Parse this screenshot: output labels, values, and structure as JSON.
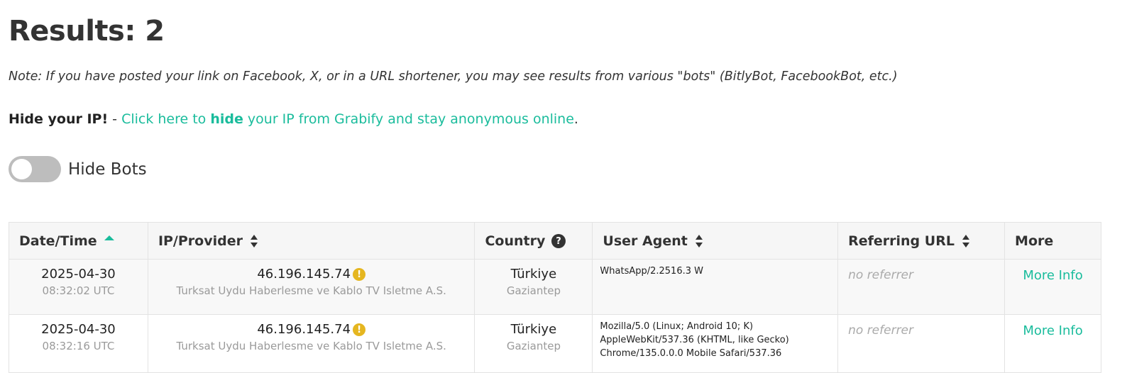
{
  "title": "Results: 2",
  "note": "Note: If you have posted your link on Facebook, X, or in a URL shortener, you may see results from various \"bots\" (BitlyBot, FacebookBot, etc.)",
  "hide_ip": {
    "lead": "Hide your IP!",
    "dash": " - ",
    "link_pre": "Click here to ",
    "link_bold": "hide",
    "link_post": " your IP from Grabify and stay anonymous online",
    "period": "."
  },
  "toggle": {
    "label": "Hide Bots",
    "on": false
  },
  "columns": {
    "datetime": "Date/Time",
    "ip": "IP/Provider",
    "country": "Country",
    "country_help": "?",
    "ua": "User Agent",
    "ref": "Referring URL",
    "more": "More"
  },
  "rows": [
    {
      "date": "2025-04-30",
      "time": "08:32:02 UTC",
      "ip": "46.196.145.74",
      "provider": "Turksat Uydu Haberlesme ve Kablo TV Isletme A.S.",
      "country": "Türkiye",
      "city": "Gaziantep",
      "user_agent": "WhatsApp/2.2516.3 W",
      "referrer": "no referrer",
      "more": "More Info"
    },
    {
      "date": "2025-04-30",
      "time": "08:32:16 UTC",
      "ip": "46.196.145.74",
      "provider": "Turksat Uydu Haberlesme ve Kablo TV Isletme A.S.",
      "country": "Türkiye",
      "city": "Gaziantep",
      "user_agent": "Mozilla/5.0 (Linux; Android 10; K) AppleWebKit/537.36 (KHTML, like Gecko) Chrome/135.0.0.0 Mobile Safari/537.36",
      "referrer": "no referrer",
      "more": "More Info"
    }
  ],
  "icons": {
    "warning": "!",
    "warning_color": "#e5b620",
    "accent": "#1abc9c"
  }
}
